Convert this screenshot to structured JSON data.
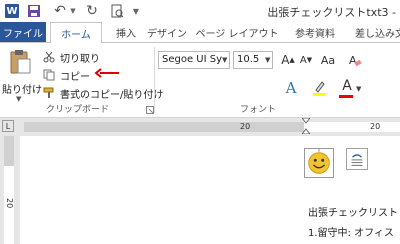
{
  "app": {
    "logo_letter": "W",
    "document_title": "出張チェックリストtxt3 -"
  },
  "quick_access": {
    "icons": [
      "word-icon",
      "save-icon",
      "undo-icon",
      "redo-icon",
      "print-icon"
    ]
  },
  "tabs": {
    "file": "ファイル",
    "home": "ホーム",
    "insert": "挿入",
    "design": "デザイン",
    "layout": "ページ レイアウト",
    "references": "参考資料",
    "mailings": "差し込み文"
  },
  "clipboard": {
    "paste_label": "貼り付け",
    "cut_label": "切り取り",
    "copy_label": "コピー",
    "format_painter_label": "書式のコピー/貼り付け",
    "group_label": "クリップボード"
  },
  "font": {
    "font_name": "Segoe UI Sy",
    "font_size": "10.5",
    "grow_label": "A",
    "shrink_label": "A",
    "case_label": "Aa",
    "text_effects_label": "A",
    "font_color_label": "A",
    "group_label": "フォント"
  },
  "ruler": {
    "h_left": "20",
    "h_right": "20",
    "v_mark": "20",
    "corner": "L"
  },
  "document": {
    "line1": "出張チェックリスト",
    "line2": "1.留守中: オフィス"
  },
  "colors": {
    "accent": "#2b579a",
    "annotation_arrow": "#e00000",
    "font_color_bar": "#e00000"
  }
}
